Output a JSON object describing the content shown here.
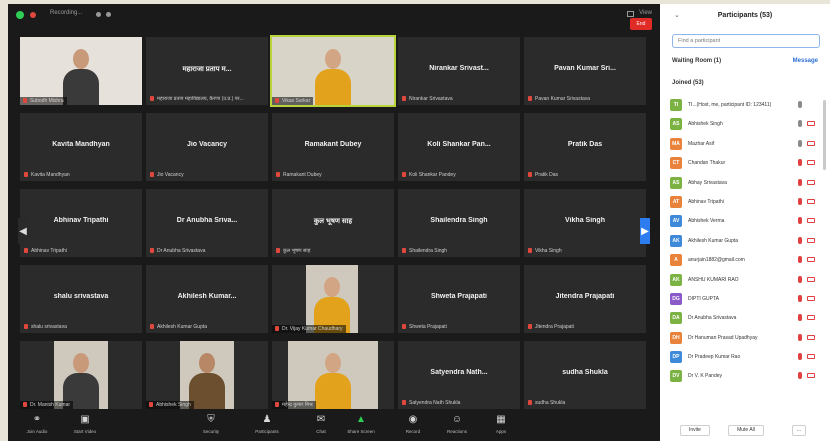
{
  "topbar": {
    "recording_label": "Recording...",
    "view_label": "View"
  },
  "tiles": [
    {
      "name": "",
      "caption": "Subodh Mishra",
      "video": true
    },
    {
      "name": "महाराजा प्रताप म...",
      "caption": "महाराजा प्रताप महाविद्यालय, कैरणा (उ.प्र.) पर...",
      "video": false
    },
    {
      "name": "",
      "caption": "Vikas Sarkar",
      "video": true,
      "active": true
    },
    {
      "name": "Nirankar Srivast...",
      "caption": "Nirankar Srivastava",
      "video": false
    },
    {
      "name": "Pavan Kumar Sri...",
      "caption": "Pavan Kumar Srivastava",
      "video": false
    },
    {
      "name": "Kavita Mandhyan",
      "caption": "Kavita Mandhyan",
      "video": false
    },
    {
      "name": "Jio Vacancy",
      "caption": "Jio Vacancy",
      "video": false
    },
    {
      "name": "Ramakant Dubey",
      "caption": "Ramakant Dubey",
      "video": false
    },
    {
      "name": "Koli Shankar Pan...",
      "caption": "Koli Shankar Pandey",
      "video": false
    },
    {
      "name": "Pratik Das",
      "caption": "Pratik Das",
      "video": false
    },
    {
      "name": "Abhinav Tripathi",
      "caption": "Abhinav Tripathi",
      "video": false
    },
    {
      "name": "Dr Anubha Sriva...",
      "caption": "Dr Anubha Srivastava",
      "video": false
    },
    {
      "name": "कुल भूषण साह",
      "caption": "कुल भूषण साह",
      "video": false
    },
    {
      "name": "Shailendra Singh",
      "caption": "Shailendra Singh",
      "video": false
    },
    {
      "name": "Vikha Singh",
      "caption": "Vikha Singh",
      "video": false
    },
    {
      "name": "shalu srivastava",
      "caption": "shalu srivastava",
      "video": false
    },
    {
      "name": "Akhilesh Kumar...",
      "caption": "Akhilesh Kumar Gupta",
      "video": false
    },
    {
      "name": "",
      "caption": "Dr. Vijay Kumar Chaudhary",
      "video": true
    },
    {
      "name": "Shweta Prajapati",
      "caption": "Shweta Prajapati",
      "video": false
    },
    {
      "name": "Jitendra Prajapati",
      "caption": "Jitendra Prajapati",
      "video": false
    },
    {
      "name": "",
      "caption": "Dr. Manish Kumar",
      "video": true
    },
    {
      "name": "",
      "caption": "Abhishek Singh",
      "video": true
    },
    {
      "name": "",
      "caption": "महेन्द्र कुमार मिश्र",
      "video": true
    },
    {
      "name": "Satyendra Nath...",
      "caption": "Satyendra Nath Shukla",
      "video": false
    },
    {
      "name": "sudha Shukla",
      "caption": "sudha Shukla",
      "video": false
    }
  ],
  "toolbar": {
    "items": [
      {
        "label": "Join Audio",
        "icon": "headphones-icon"
      },
      {
        "label": "Start Video",
        "icon": "video-off-icon"
      },
      {
        "label": "Security",
        "icon": "shield-icon"
      },
      {
        "label": "Participants",
        "icon": "participants-icon"
      },
      {
        "label": "Chat",
        "icon": "chat-icon"
      },
      {
        "label": "Share Screen",
        "icon": "share-screen-icon"
      },
      {
        "label": "Record",
        "icon": "record-icon"
      },
      {
        "label": "Reactions",
        "icon": "reactions-icon"
      },
      {
        "label": "Apps",
        "icon": "apps-icon"
      }
    ],
    "end_label": "End"
  },
  "panel": {
    "title": "Participants (53)",
    "search_placeholder": "Find a participant",
    "waiting_room": "Waiting Room (1)",
    "message_label": "Message",
    "joined": "Joined (53)",
    "participants": [
      {
        "initials": "TI",
        "name": "TI...(Host, me, participant ID: 123411)",
        "color": "#7bb243"
      },
      {
        "initials": "AS",
        "name": "Abhishek Singh",
        "color": "#7bb243"
      },
      {
        "initials": "MA",
        "name": "Mazhar Asif",
        "color": "#e9823a"
      },
      {
        "initials": "CT",
        "name": "Chandan Thakur",
        "color": "#e9823a"
      },
      {
        "initials": "AS",
        "name": "Abhay Srivastava",
        "color": "#7bb243"
      },
      {
        "initials": "AT",
        "name": "Abhinav Tripathi",
        "color": "#e9823a"
      },
      {
        "initials": "AV",
        "name": "Abhishek Verma",
        "color": "#3f8ad8"
      },
      {
        "initials": "AK",
        "name": "Akhilesh Kumar Gupta",
        "color": "#3f8ad8"
      },
      {
        "initials": "A",
        "name": "anurjain1882@gmail.com",
        "color": "#e9823a"
      },
      {
        "initials": "AK",
        "name": "ANSHU KUMARI RAO",
        "color": "#7bb243"
      },
      {
        "initials": "DG",
        "name": "DIPTI GUPTA",
        "color": "#8a5ac8"
      },
      {
        "initials": "DA",
        "name": "Dr Anubha Srivastava",
        "color": "#7bb243"
      },
      {
        "initials": "DH",
        "name": "Dr Hanuman Prasad Upadhyay",
        "color": "#e9823a"
      },
      {
        "initials": "DP",
        "name": "Dr Pradeep Kumar Rao",
        "color": "#3f8ad8"
      },
      {
        "initials": "DV",
        "name": "Dr V. K Pandey",
        "color": "#7bb243"
      }
    ],
    "invite_label": "Invite",
    "mute_all_label": "Mute All",
    "more_label": "..."
  }
}
